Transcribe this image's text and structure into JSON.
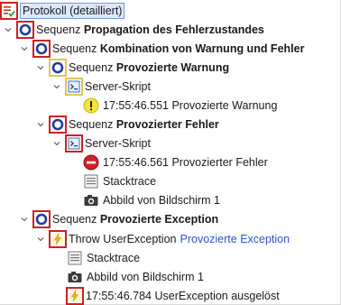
{
  "tree": {
    "root": {
      "label": "Protokoll (detailliert)",
      "icon": "protocol-list-icon"
    },
    "seq1": {
      "prefix": "Sequenz",
      "name": "Propagation des Fehlerzustandes"
    },
    "seq1a": {
      "prefix": "Sequenz",
      "name": "Kombination von Warnung und Fehler"
    },
    "seq_warn": {
      "prefix": "Sequenz",
      "name": "Provozierte Warnung"
    },
    "script_warn": {
      "label": "Server-Skript"
    },
    "warn_msg": {
      "label": "17:55:46.551 Provozierte Warnung"
    },
    "seq_err": {
      "prefix": "Sequenz",
      "name": "Provozierter Fehler"
    },
    "script_err": {
      "label": "Server-Skript"
    },
    "err_msg": {
      "label": "17:55:46.561 Provozierter Fehler"
    },
    "err_stack": {
      "label": "Stacktrace"
    },
    "err_shot": {
      "label": "Abbild von Bildschirm 1"
    },
    "seq_exc": {
      "prefix": "Sequenz",
      "name": "Provozierte Exception"
    },
    "throw": {
      "prefix": "Throw UserException",
      "link": "Provozierte Exception"
    },
    "exc_stack": {
      "label": "Stacktrace"
    },
    "exc_shot": {
      "label": "Abbild von Bildschirm 1"
    },
    "exc_msg": {
      "label": "17:55:46.784 UserException ausgelöst"
    }
  },
  "colors": {
    "error_frame": "#d12020",
    "warning_frame": "#e2c35a",
    "sequence_ring": "#1c3f9e",
    "link": "#2e55c9",
    "selection": "#dce8fb"
  }
}
